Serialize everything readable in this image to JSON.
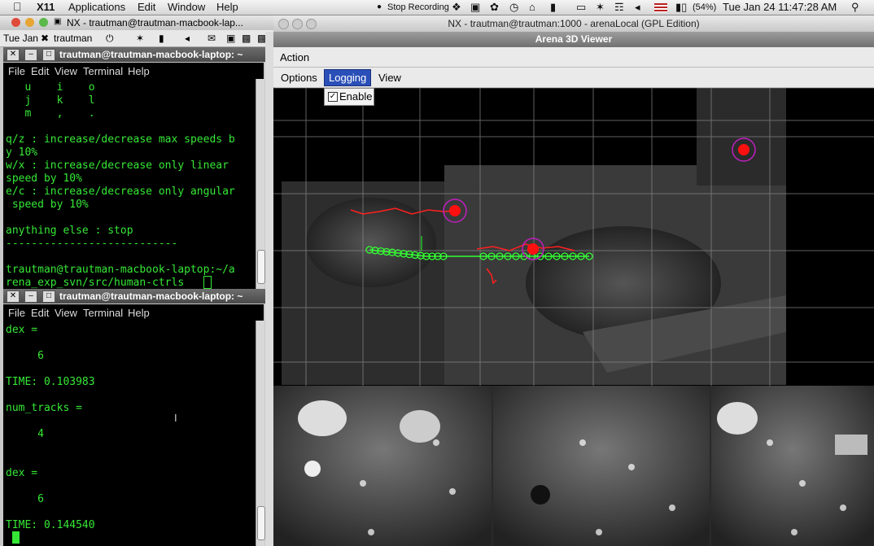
{
  "menubar": {
    "items": [
      "X11",
      "Applications",
      "Edit",
      "Window",
      "Help"
    ],
    "status": {
      "recording": "Stop Recording",
      "battery": "(54%)",
      "datetime": "Tue Jan 24  11:47:28 AM"
    }
  },
  "nx_left": {
    "title": "NX - trautman@trautman-macbook-lap..."
  },
  "gnome_panel": {
    "date": "Tue Jan",
    "user": "trautman"
  },
  "nx_right": {
    "title": "NX - trautman@trautman:1000 - arenaLocal (GPL Edition)"
  },
  "terminal1": {
    "title": "trautman@trautman-macbook-laptop: ~",
    "menu": [
      "File",
      "Edit",
      "View",
      "Terminal",
      "Help"
    ],
    "lines": [
      "   u    i    o",
      "   j    k    l",
      "   m    ,    .",
      "",
      "q/z : increase/decrease max speeds b",
      "y 10%",
      "w/x : increase/decrease only linear",
      "speed by 10%",
      "e/c : increase/decrease only angular",
      " speed by 10%",
      "",
      "anything else : stop",
      "---------------------------",
      "",
      "trautman@trautman-macbook-laptop:~/a",
      "rena_exp_svn/src/human-ctrls "
    ]
  },
  "terminal2": {
    "title": "trautman@trautman-macbook-laptop: ~",
    "menu": [
      "File",
      "Edit",
      "View",
      "Terminal",
      "Help"
    ],
    "lines": [
      "dex =",
      "",
      "     6",
      "",
      "TIME: 0.103983",
      "",
      "num_tracks =",
      "",
      "     4",
      "",
      "",
      "dex =",
      "",
      "     6",
      "",
      "TIME: 0.144540"
    ]
  },
  "arena": {
    "title": "Arena 3D Viewer",
    "action": "Action",
    "menu": [
      "Options",
      "Logging",
      "View"
    ],
    "logging_checkbox": "Enable",
    "colors": {
      "grid": "#8a8a8a",
      "track_red": "#ff1a1a",
      "track_green": "#33ff33",
      "ring": "#c020c0"
    }
  }
}
